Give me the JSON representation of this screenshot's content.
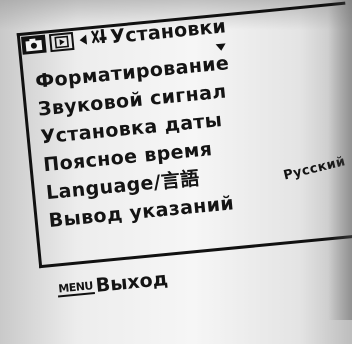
{
  "menu": {
    "title": "Установки",
    "tabs": [
      "camera-icon",
      "playback-icon",
      "setup-icon"
    ],
    "items": [
      {
        "label": "Форматирование",
        "value": "checked"
      },
      {
        "label": "Звуковой сигнал",
        "value": "checked"
      },
      {
        "label": "Установка даты",
        "value": ""
      },
      {
        "label": "Поясное время",
        "value": ""
      },
      {
        "label": "Language/言語",
        "value": "Русский"
      },
      {
        "label": "Вывод указаний",
        "value": "checked"
      }
    ],
    "item_values": {
      "sound": "checked",
      "date": "unchecked",
      "language": "Русский",
      "guide": "checked"
    }
  },
  "footer": {
    "key": "MENU",
    "label": "Выход"
  }
}
